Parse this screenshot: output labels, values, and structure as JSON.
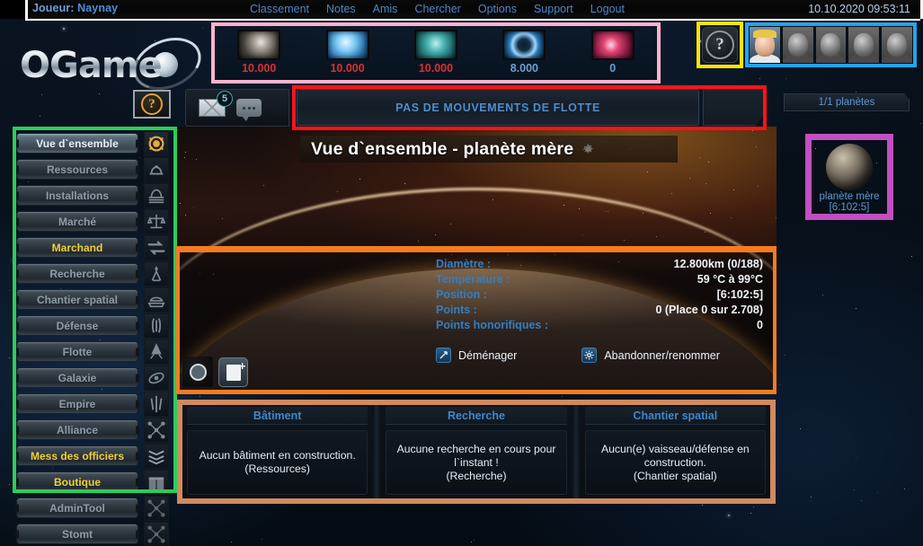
{
  "topbar": {
    "player_label": "Joueur:",
    "player_name": "Naynay",
    "nav": [
      {
        "label": "Classement"
      },
      {
        "label": "Notes"
      },
      {
        "label": "Amis"
      },
      {
        "label": "Chercher"
      },
      {
        "label": "Options"
      },
      {
        "label": "Support"
      },
      {
        "label": "Logout"
      }
    ],
    "datetime": "10.10.2020 09:53:11"
  },
  "logo": {
    "text": "OGame"
  },
  "resources": [
    {
      "name": "metal",
      "value": "10.000",
      "color": "#d8322f"
    },
    {
      "name": "crystal",
      "value": "10.000",
      "color": "#d8322f"
    },
    {
      "name": "deuterium",
      "value": "10.000",
      "color": "#d8322f"
    },
    {
      "name": "energy",
      "value": "8.000",
      "color": "#6e9fd0"
    },
    {
      "name": "darkmatter",
      "value": "0",
      "color": "#6e9fd0"
    }
  ],
  "help": {
    "glyph": "?"
  },
  "officers": [
    {
      "name": "commander",
      "active": true
    },
    {
      "name": "admiral",
      "active": false
    },
    {
      "name": "engineer",
      "active": false
    },
    {
      "name": "geologist",
      "active": false
    },
    {
      "name": "technocrat",
      "active": false
    }
  ],
  "messages": {
    "count": "5"
  },
  "fleet": {
    "banner": "PAS DE MOUVEMENTS DE FLOTTE"
  },
  "planet_counter": {
    "label": "1/1 planètes"
  },
  "sidebar": {
    "items": [
      {
        "label": "Vue d`ensemble",
        "icon": "overview-icon",
        "state": "active"
      },
      {
        "label": "Ressources",
        "icon": "resources-icon",
        "state": "normal"
      },
      {
        "label": "Installations",
        "icon": "facilities-icon",
        "state": "normal"
      },
      {
        "label": "Marché",
        "icon": "market-icon",
        "state": "normal"
      },
      {
        "label": "Marchand",
        "icon": "trader-icon",
        "state": "gold"
      },
      {
        "label": "Recherche",
        "icon": "research-icon",
        "state": "normal"
      },
      {
        "label": "Chantier spatial",
        "icon": "shipyard-icon",
        "state": "normal"
      },
      {
        "label": "Défense",
        "icon": "defence-icon",
        "state": "normal"
      },
      {
        "label": "Flotte",
        "icon": "fleet-icon",
        "state": "normal"
      },
      {
        "label": "Galaxie",
        "icon": "galaxy-icon",
        "state": "normal"
      },
      {
        "label": "Empire",
        "icon": "empire-icon",
        "state": "normal"
      },
      {
        "label": "Alliance",
        "icon": "alliance-icon",
        "state": "normal"
      },
      {
        "label": "Mess des officiers",
        "icon": "officers-icon",
        "state": "gold"
      },
      {
        "label": "Boutique",
        "icon": "shop-icon",
        "state": "gold"
      },
      {
        "label": "AdminTool",
        "icon": "admin-icon",
        "state": "normal"
      },
      {
        "label": "Stomt",
        "icon": "stomt-icon",
        "state": "normal"
      }
    ]
  },
  "main": {
    "title": "Vue d`ensemble - planète mère",
    "info_rows": [
      {
        "key": "Diamètre :",
        "value": "12.800km (0/188)"
      },
      {
        "key": "Température :",
        "value": "59 °C à 99°C"
      },
      {
        "key": "Position :",
        "value": "[6:102:5]"
      },
      {
        "key": "Points :",
        "value": "0 (Place 0 sur 2.708)"
      },
      {
        "key": "Points honorifiques :",
        "value": "0"
      }
    ],
    "actions": [
      {
        "label": "Déménager",
        "icon": "move-icon"
      },
      {
        "label": "Abandonner/renommer",
        "icon": "gear-icon"
      }
    ]
  },
  "bottom_panels": [
    {
      "title": "Bâtiment",
      "body": "Aucun bâtiment en construction.\n(Ressources)"
    },
    {
      "title": "Recherche",
      "body": "Aucune recherche en cours pour l`instant !\n(Recherche)"
    },
    {
      "title": "Chantier spatial",
      "body": "Aucun(e) vaisseau/défense en construction.\n(Chantier spatial)"
    }
  ],
  "right_planet": {
    "name": "planète mère",
    "coords": "[6:102:5]"
  },
  "annotation_colors": {
    "resources": "#ffb3cd",
    "help": "#ffe400",
    "officers": "#22a5f0",
    "fleet": "#ff1414",
    "sidebar": "#2ecc57",
    "info": "#f47b20",
    "bottom": "#cf8b5e",
    "planet": "#c14fc1"
  }
}
